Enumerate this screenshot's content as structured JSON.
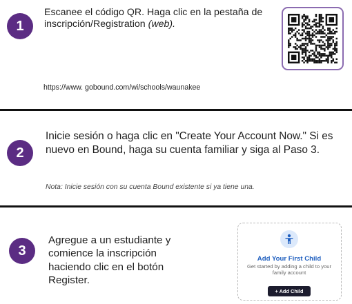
{
  "step1": {
    "number": "1",
    "text": "Escanee el código QR. Haga clic en la pestaña de inscripción/Registration",
    "web": "(web).",
    "url": "https://www. gobound.com/wi/schools/waunakee"
  },
  "step2": {
    "number": "2",
    "text": "Inicie sesión o haga clic en \"Create Your Account Now.\" Si es nuevo en Bound, haga su cuenta familiar y siga al Paso 3.",
    "note": "Nota: Inicie sesión con su cuenta Bound existente si ya tiene una."
  },
  "step3": {
    "number": "3",
    "text": "Agregue a un estudiante y comience la inscripción haciendo clic en el botón Register."
  },
  "card": {
    "icon": "child-icon",
    "title": "Add Your First Child",
    "subtitle": "Get started by adding a child to your family account",
    "button": "+ Add Child"
  },
  "colors": {
    "accent": "#5b2c83",
    "qr_border": "#8b6bb0",
    "link_blue": "#1f5fbf",
    "button_dark": "#1c1c2e"
  }
}
